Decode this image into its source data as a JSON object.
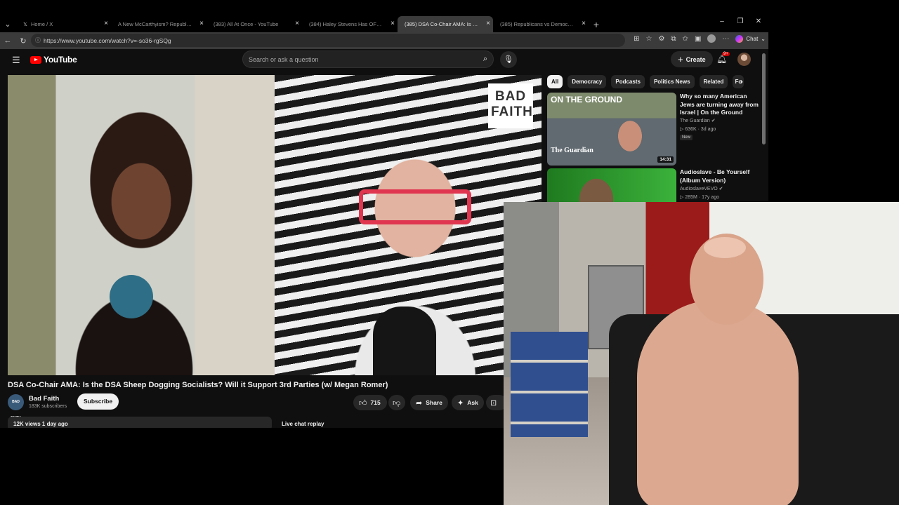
{
  "browser": {
    "tabs": [
      {
        "title": "Home / X",
        "favicon": "x-icon"
      },
      {
        "title": "A New McCarthyism? Republicans",
        "favicon": "youtube-icon"
      },
      {
        "title": "(383) All At Once - YouTube",
        "favicon": "youtube-icon"
      },
      {
        "title": "(384) Haley Stevens Has OFFICIAL",
        "favicon": "youtube-icon"
      },
      {
        "title": "(385) DSA Co-Chair AMA: Is the D",
        "favicon": "youtube-icon",
        "active": true
      },
      {
        "title": "(385) Republicans vs Democrats C",
        "favicon": "youtube-icon"
      }
    ],
    "url": "https://www.youtube.com/watch?v=-so36-rgSQg",
    "chat_label": "Chat"
  },
  "youtube": {
    "logo_text": "YouTube",
    "search_placeholder": "Search or ask a question",
    "create_label": "Create",
    "notification_count": "9+",
    "video": {
      "title": "DSA Co-Chair AMA: Is the DSA Sheep Dogging Socialists? Will it Support 3rd Parties (w/ Megan Romer)",
      "overlay_logo": "BAD FAITH",
      "channel": "Bad Faith",
      "channel_avatar_text": "BAD FAITH",
      "subscribers": "183K subscribers",
      "subscribe_label": "Subscribe",
      "likes": "715",
      "share_label": "Share",
      "ask_label": "Ask",
      "views_date": "12K views  1 day ago",
      "live_chat_label": "Live chat replay"
    },
    "chips": [
      "All",
      "Democracy",
      "Podcasts",
      "Politics News",
      "Related",
      "Fo"
    ],
    "recommendations": [
      {
        "title": "Why so many American Jews are turning away from Israel | On the Ground",
        "channel": "The Guardian",
        "meta": "636K · 3d ago",
        "badge": "New",
        "duration": "14:31",
        "thumb_text_top": "ON THE GROUND",
        "thumb_text_bottom": "The Guardian"
      },
      {
        "title": "Audioslave - Be Yourself (Album Version)",
        "channel": "AudioslaveVEVO",
        "meta": "285M · 17y ago"
      }
    ]
  },
  "colors": {
    "youtube_red": "#ff0000",
    "page_bg": "#0f0f0f",
    "chip_bg": "#272727"
  }
}
